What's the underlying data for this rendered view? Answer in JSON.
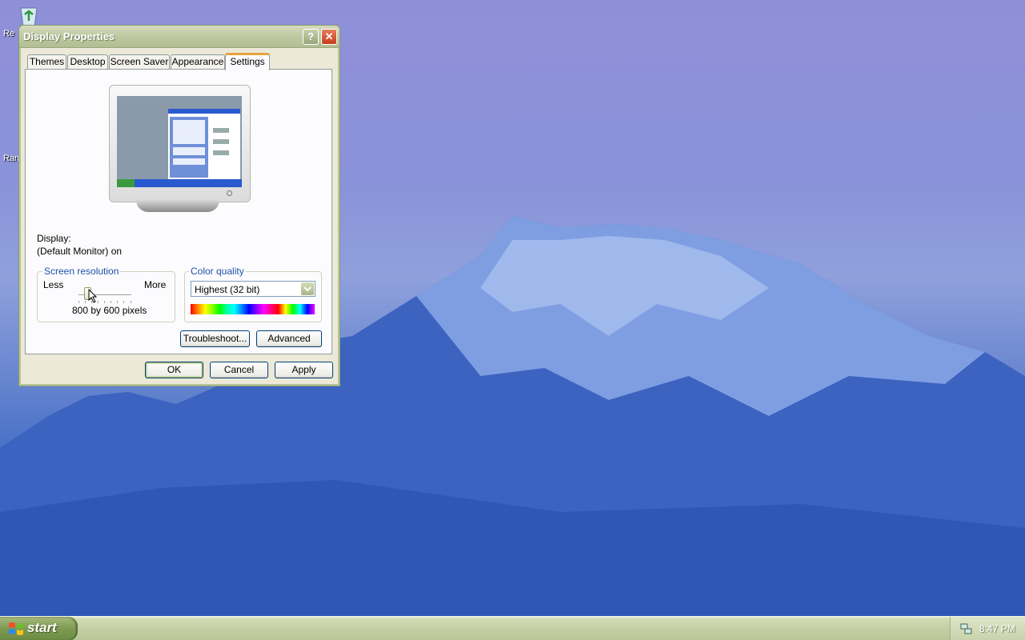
{
  "desktop": {
    "icons": [
      {
        "label": "Re",
        "icon": "recycle-bin-icon"
      },
      {
        "label": "Ran",
        "icon": "shortcut-icon"
      }
    ]
  },
  "window": {
    "title": "Display Properties",
    "help_label": "?",
    "close_label": "✕",
    "tabs": [
      {
        "label": "Themes"
      },
      {
        "label": "Desktop"
      },
      {
        "label": "Screen Saver"
      },
      {
        "label": "Appearance"
      },
      {
        "label": "Settings",
        "active": true
      }
    ],
    "display_label": "Display:",
    "display_value": "(Default Monitor) on",
    "resolution": {
      "group_title": "Screen resolution",
      "less_label": "Less",
      "more_label": "More",
      "value_text": "800 by 600 pixels"
    },
    "color_quality": {
      "group_title": "Color quality",
      "selected": "Highest (32 bit)"
    },
    "buttons": {
      "troubleshoot": "Troubleshoot...",
      "advanced": "Advanced",
      "ok": "OK",
      "cancel": "Cancel",
      "apply": "Apply"
    }
  },
  "taskbar": {
    "start_label": "start",
    "clock": "8:47 PM"
  },
  "colors": {
    "title_bar": "#b1bd92",
    "tab_active_accent": "#e6a23c",
    "group_title": "#2050a8",
    "taskbar": "#c5cfa5"
  }
}
